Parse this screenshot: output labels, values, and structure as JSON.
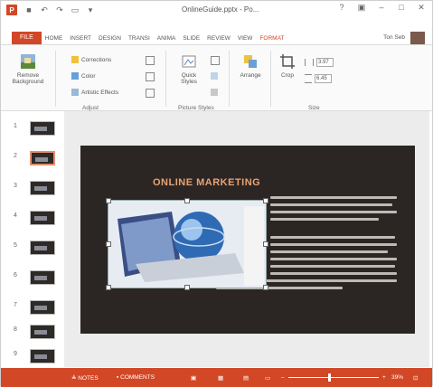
{
  "titlebar": {
    "doc_title": "OnlineGuide.pptx - Po...",
    "controls": [
      "?",
      "▣",
      "–",
      "□",
      "✕"
    ]
  },
  "tabs": {
    "file": "FILE",
    "items": [
      "HOME",
      "INSERT",
      "DESIGN",
      "TRANSI",
      "ANIMA",
      "SLIDE",
      "REVIEW",
      "VIEW",
      "FORMAT"
    ],
    "contextual_index": 8,
    "signin": "Ton Seb"
  },
  "ribbon": {
    "remove_background": "Remove Background",
    "corrections": "Corrections",
    "color": "Color",
    "artistic_effects": "Artistic Effects",
    "quick_styles": "Quick Styles",
    "arrange": "Arrange",
    "crop": "Crop",
    "height": "3.97",
    "width": "6.45",
    "groups": [
      "Adjust",
      "Picture Styles",
      "Size"
    ]
  },
  "thumbnails": [
    "1",
    "2",
    "3",
    "4",
    "5",
    "6",
    "7",
    "8",
    "9"
  ],
  "slide": {
    "title": "ONLINE MARKETING"
  },
  "status": {
    "notes": "NOTES",
    "comments": "COMMENTS",
    "zoom": "39%"
  },
  "colors": {
    "accent": "#d24726",
    "slide_bg": "#2b2624",
    "title": "#e8a372"
  }
}
